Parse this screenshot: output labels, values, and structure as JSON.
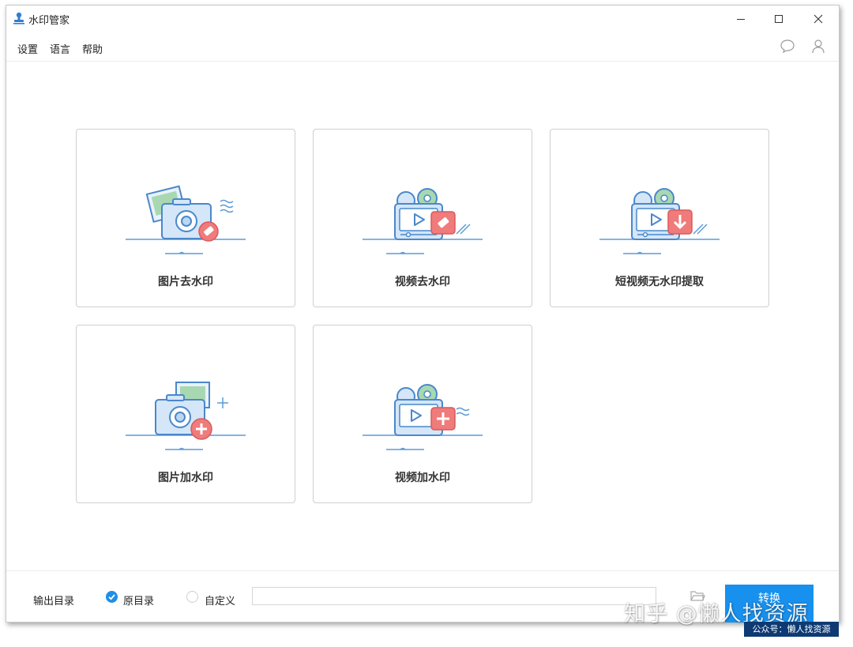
{
  "window": {
    "title": "水印管家"
  },
  "menu": {
    "items": [
      "设置",
      "语言",
      "帮助"
    ]
  },
  "features": [
    {
      "label": "图片去水印",
      "icon": "photo-remove-watermark-icon"
    },
    {
      "label": "视频去水印",
      "icon": "video-remove-watermark-icon"
    },
    {
      "label": "短视频无水印提取",
      "icon": "short-video-extract-icon"
    },
    {
      "label": "图片加水印",
      "icon": "photo-add-watermark-icon"
    },
    {
      "label": "视频加水印",
      "icon": "video-add-watermark-icon"
    }
  ],
  "footer": {
    "output_label": "输出目录",
    "option_original": "原目录",
    "option_custom": "自定义",
    "path_value": "",
    "convert_label": "转换"
  },
  "overlay": {
    "zhihu_watermark": "知乎 @懒人找资源",
    "public_account_watermark": "公众号：懒人找资源"
  },
  "colors": {
    "accent": "#1890ee",
    "icon_blue": "#4a90d9",
    "icon_light_blue": "#dbeaf8",
    "icon_red": "#f07b7b",
    "icon_green": "#9ccfa6"
  }
}
